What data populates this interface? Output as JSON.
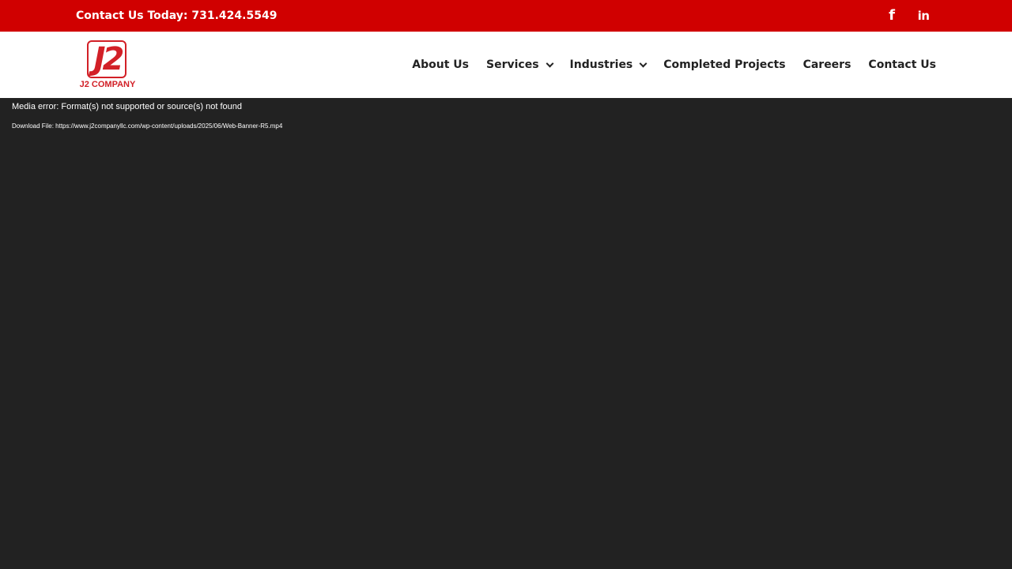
{
  "topbar": {
    "phone_text": "Contact Us Today: 731.424.5549",
    "social": [
      {
        "icon": "facebook-icon",
        "glyph": "f"
      },
      {
        "icon": "linkedin-icon",
        "glyph": "in"
      }
    ],
    "background_color": "#d00000"
  },
  "header": {
    "logo": {
      "mark_text": "J2",
      "wordmark": "J2 COMPANY",
      "brand_color": "#d22027"
    },
    "nav": [
      {
        "label": "About Us",
        "has_dropdown": false
      },
      {
        "label": "Services",
        "has_dropdown": true
      },
      {
        "label": "Industries",
        "has_dropdown": true
      },
      {
        "label": "Completed Projects",
        "has_dropdown": false
      },
      {
        "label": "Careers",
        "has_dropdown": false
      },
      {
        "label": "Contact Us",
        "has_dropdown": false
      }
    ]
  },
  "media": {
    "error_text": "Media error: Format(s) not supported or source(s) not found",
    "download_label": "Download File:",
    "download_url": "https://www.j2companyllc.com/wp-content/uploads/2025/06/Web-Banner-R5.mp4",
    "background_color": "#222222"
  }
}
